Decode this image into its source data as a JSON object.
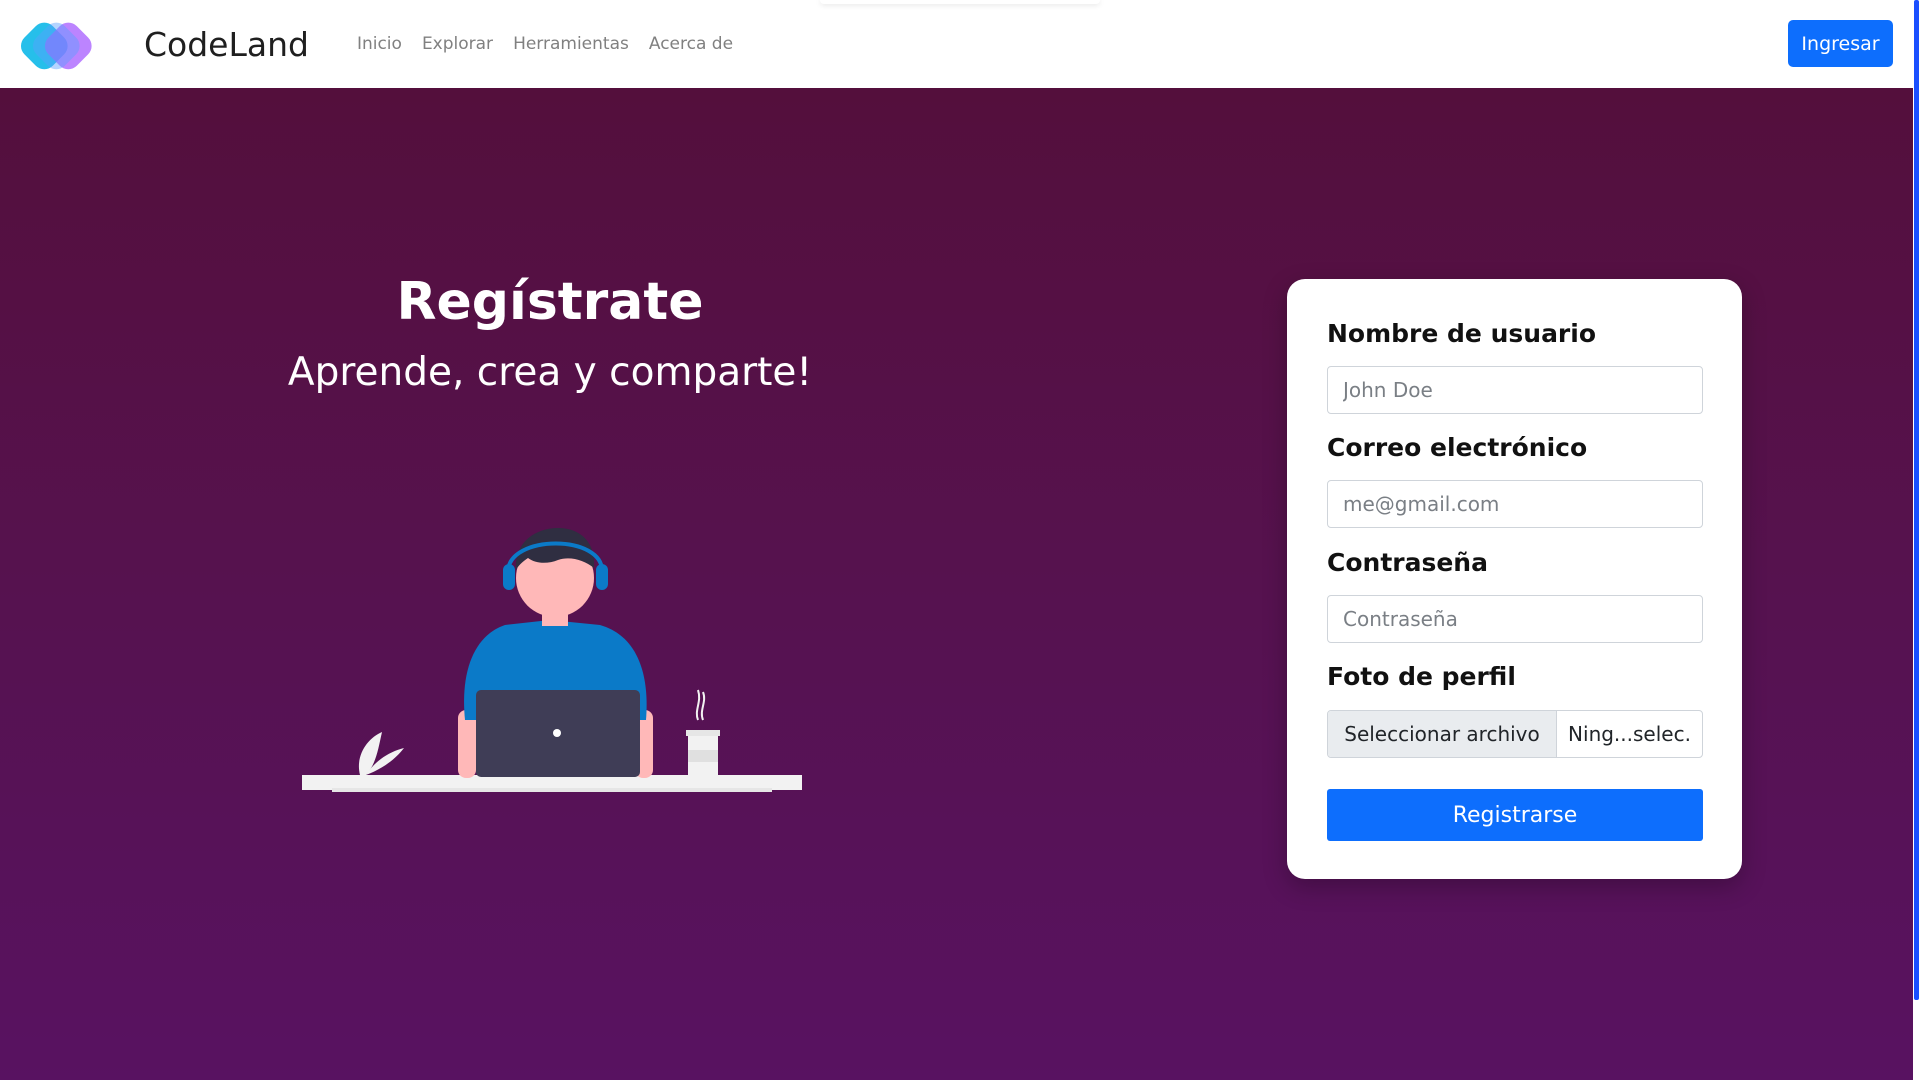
{
  "nav": {
    "brand": "CodeLand",
    "links": [
      "Inicio",
      "Explorar",
      "Herramientas",
      "Acerca de"
    ],
    "login_label": "Ingresar"
  },
  "hero": {
    "title": "Regístrate",
    "subtitle": "Aprende, crea y comparte!"
  },
  "form": {
    "username_label": "Nombre de usuario",
    "username_placeholder": "John Doe",
    "email_label": "Correo electrónico",
    "email_placeholder": "me@gmail.com",
    "password_label": "Contraseña",
    "password_placeholder": "Contraseña",
    "photo_label": "Foto de perfil",
    "file_button": "Seleccionar archivo",
    "file_status": "Ning...selec.",
    "submit_label": "Registrarse"
  },
  "colors": {
    "primary": "#0d6efd",
    "hero_top": "#540f3c",
    "hero_bottom": "#581261",
    "shirt": "#0b7ac8",
    "laptop": "#3f3d56"
  }
}
